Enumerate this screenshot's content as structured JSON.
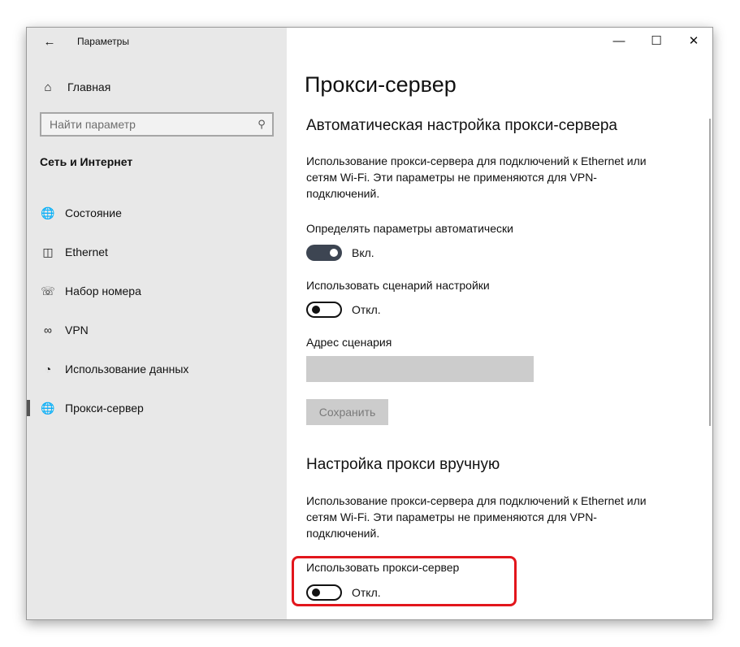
{
  "window": {
    "title": "Параметры",
    "controls": {
      "minimize": "—",
      "maximize": "☐",
      "close": "✕"
    }
  },
  "sidebar": {
    "back_icon": "back-arrow-icon",
    "home": {
      "label": "Главная",
      "icon": "home-icon"
    },
    "search": {
      "placeholder": "Найти параметр",
      "icon": "search-icon"
    },
    "section_title": "Сеть и Интернет",
    "items": [
      {
        "label": "Состояние",
        "icon": "globe-status-icon"
      },
      {
        "label": "Ethernet",
        "icon": "ethernet-icon"
      },
      {
        "label": "Набор номера",
        "icon": "dialup-icon"
      },
      {
        "label": "VPN",
        "icon": "vpn-icon"
      },
      {
        "label": "Использование данных",
        "icon": "data-usage-icon"
      },
      {
        "label": "Прокси-сервер",
        "icon": "globe-proxy-icon",
        "active": true
      }
    ]
  },
  "main": {
    "title": "Прокси-сервер",
    "auto": {
      "heading": "Автоматическая настройка прокси-сервера",
      "description": "Использование прокси-сервера для подключений к Ethernet или сетям Wi-Fi. Эти параметры не применяются для VPN-подключений.",
      "detect_label": "Определять параметры автоматически",
      "detect_state": "Вкл.",
      "detect_on": true,
      "script_label": "Использовать сценарий настройки",
      "script_state": "Откл.",
      "script_on": false,
      "address_label": "Адрес сценария",
      "address_value": "",
      "save_label": "Сохранить"
    },
    "manual": {
      "heading": "Настройка прокси вручную",
      "description": "Использование прокси-сервера для подключений к Ethernet или сетям Wi-Fi. Эти параметры не применяются для VPN-подключений.",
      "use_proxy_label": "Использовать прокси-сервер",
      "use_proxy_state": "Откл.",
      "use_proxy_on": false
    }
  },
  "colors": {
    "sidebar_bg": "#e8e8e8",
    "toggle_on": "#3d4552",
    "highlight": "#e2161c",
    "disabled_bg": "#cccccc"
  }
}
